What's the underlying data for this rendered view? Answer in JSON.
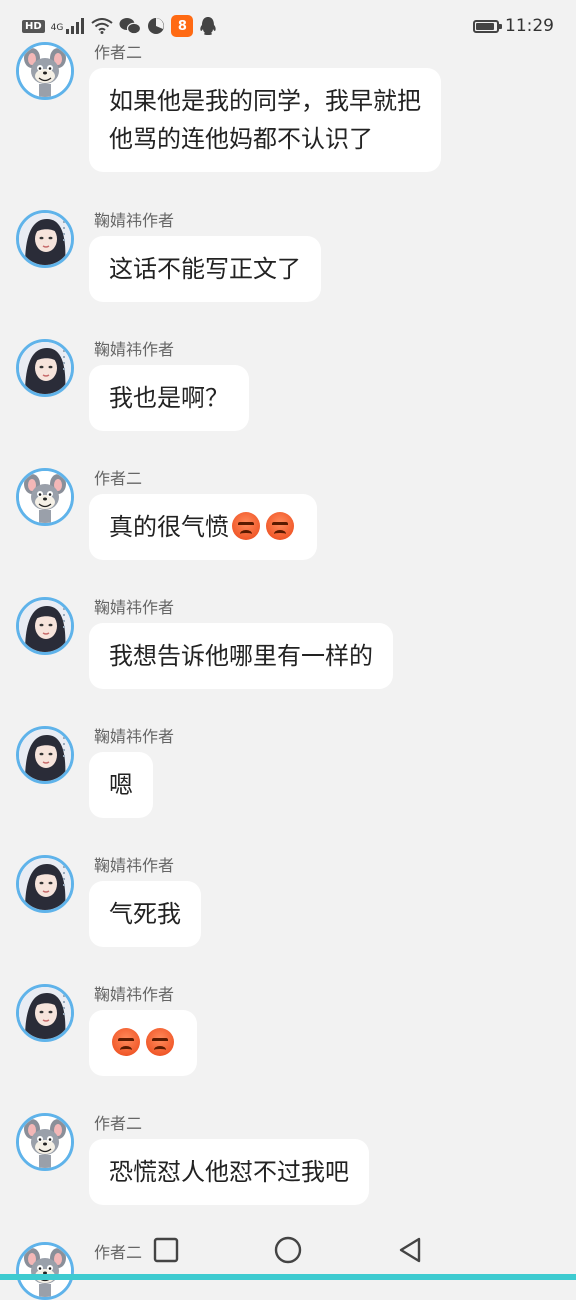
{
  "status_bar": {
    "hd": "HD",
    "network": "4G",
    "time": "11:29",
    "kuaikan_label": "8",
    "battery_level": 0.9
  },
  "messages": [
    {
      "sender": "作者二",
      "avatar": "tom-cat-avatar",
      "text": "如果他是我的同学，我早就把\n他骂的连他妈都不认识了",
      "emojis": 0
    },
    {
      "sender": "鞠婧祎作者",
      "avatar": "girl-avatar",
      "text": "这话不能写正文了",
      "emojis": 0
    },
    {
      "sender": "鞠婧祎作者",
      "avatar": "girl-avatar",
      "text": "我也是啊？",
      "emojis": 0
    },
    {
      "sender": "作者二",
      "avatar": "tom-cat-avatar",
      "text": "真的很气愤",
      "emojis": 2
    },
    {
      "sender": "鞠婧祎作者",
      "avatar": "girl-avatar",
      "text": "我想告诉他哪里有一样的",
      "emojis": 0
    },
    {
      "sender": "鞠婧祎作者",
      "avatar": "girl-avatar",
      "text": "嗯",
      "emojis": 0
    },
    {
      "sender": "鞠婧祎作者",
      "avatar": "girl-avatar",
      "text": "气死我",
      "emojis": 0
    },
    {
      "sender": "鞠婧祎作者",
      "avatar": "girl-avatar",
      "text": "",
      "emojis": 2
    },
    {
      "sender": "作者二",
      "avatar": "tom-cat-avatar",
      "text": "恐慌怼人他怼不过我吧",
      "emojis": 0
    },
    {
      "sender": "作者二",
      "avatar": "tom-cat-avatar",
      "text": "",
      "emojis": 0
    }
  ],
  "colors": {
    "background": "#f2f2f2",
    "bubble": "#ffffff",
    "avatar_border": "#5fb3ea",
    "bottom_accent": "#3ecbd0"
  }
}
